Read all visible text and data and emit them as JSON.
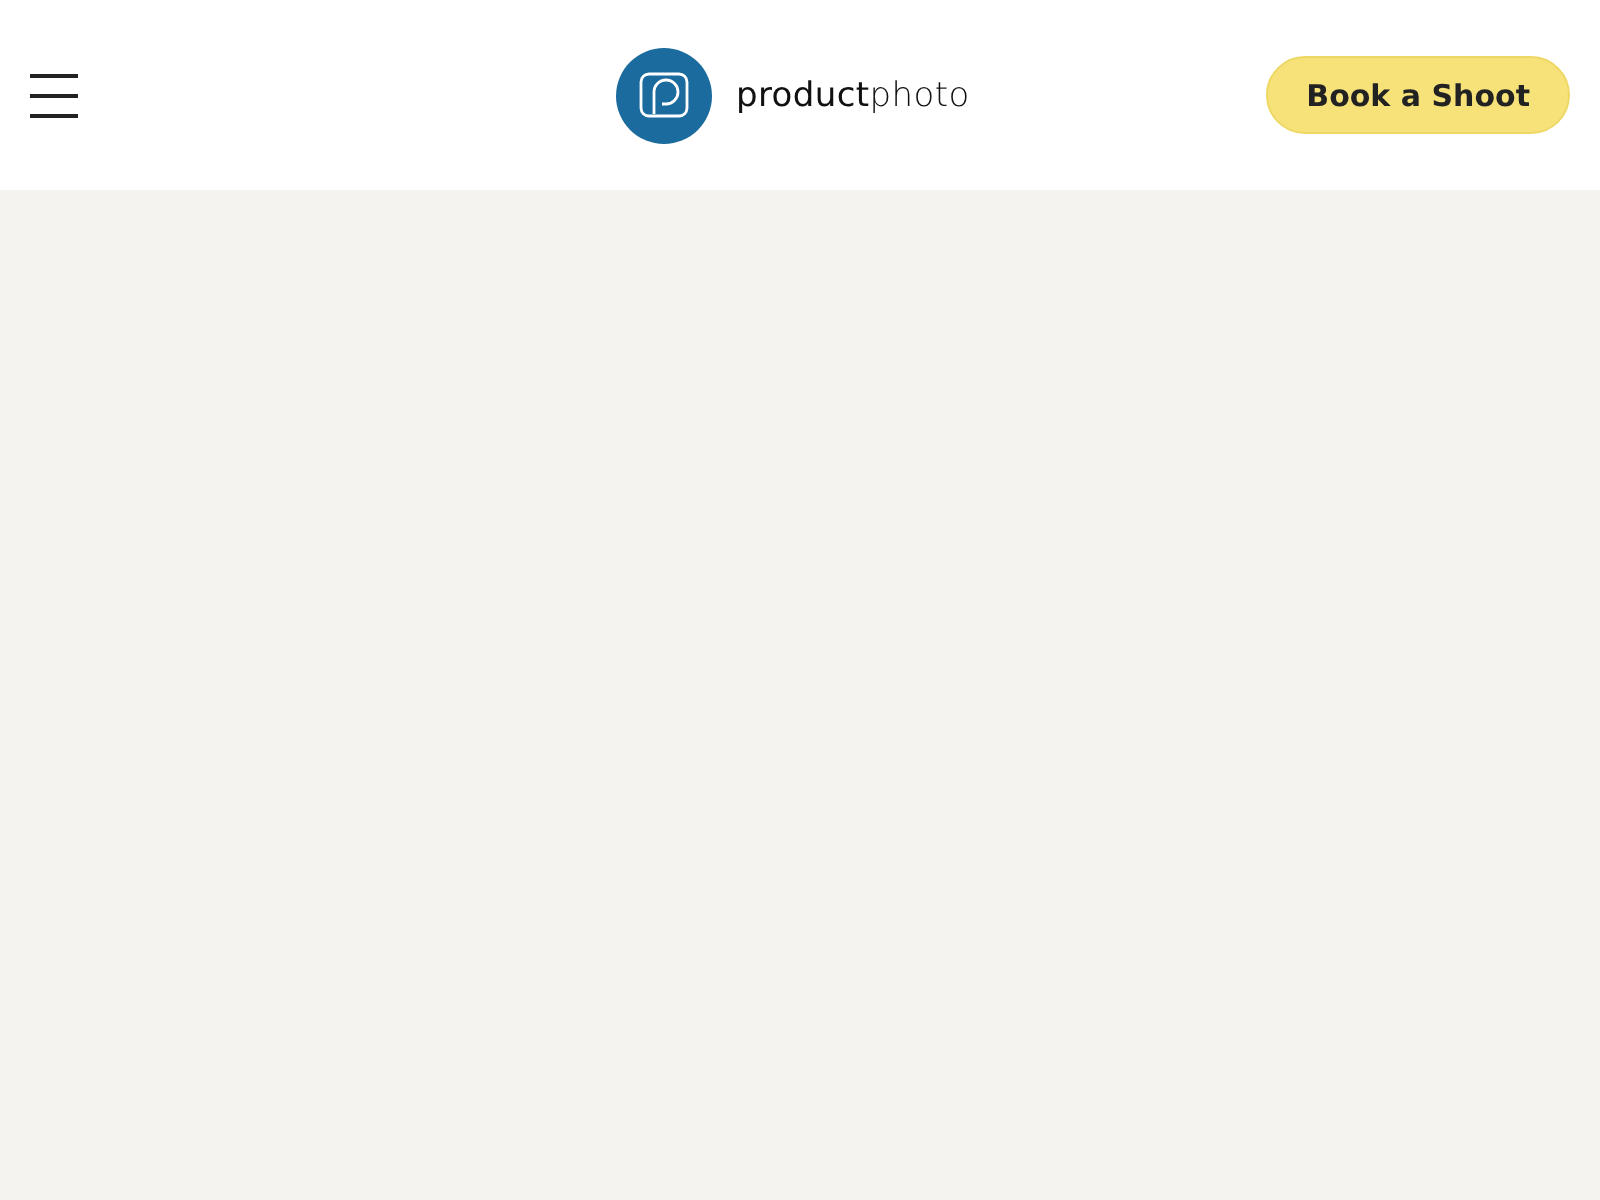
{
  "header": {
    "logo_text": "**product**photo",
    "cta": "Book a Shoot"
  }
}
